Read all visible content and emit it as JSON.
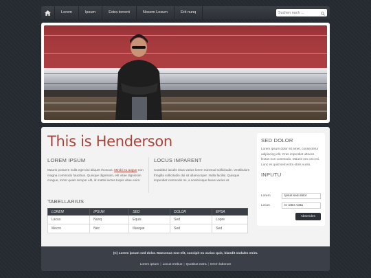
{
  "nav": {
    "items": [
      "Lorem",
      "Ipsum",
      "Extra torrent",
      "Nosem Lesum",
      "Erit nunq"
    ]
  },
  "search": {
    "placeholder": "Suchen nach ..."
  },
  "main": {
    "title": "This is Henderson",
    "col1": {
      "heading": "LOREM IPSUM",
      "text_a": "Mauris posuere nulla eget dui aliquet rhoncus. ",
      "link": "Mircbi eu augue",
      "text_b": " non magna commodo faucibus. Quisque dignissim, elit vitae dignissim congue, tortor quam tempor elit, id mattis lectus turpis vitae enim."
    },
    "col2": {
      "heading": "LOCUS IMPARENT",
      "text": "Curabitur iaculis risus varius lorem euismod sollicitudin. Vestibulum fringilla sollicitudin dui sit ullamcorper. Nulla facilisi. Quisque imperdiet commodo mi, a scelerisque lacus varius at."
    },
    "table": {
      "heading": "TABELLARIUS",
      "columns": [
        "LOREM",
        "IPSUM",
        "SED",
        "DOLOR",
        "EPSA"
      ],
      "rows": [
        [
          "Lacus",
          "Nunq",
          "Equis",
          "Sed",
          "Lopre"
        ],
        [
          "Mecro",
          "Nec",
          "Illusque",
          "Sed",
          "Sed"
        ]
      ]
    }
  },
  "sidebar": {
    "heading1": "SED DOLOR",
    "text1": "Lorem ipsum dolor sit amet, consectetur adipiscing elit. Cras imperdiet ultrices lectus non commodo. Mauris nec orci mi. Lunc es quid sed extra obris vunlu.",
    "heading2": "INPUTU",
    "fields": [
      {
        "label": "Lorem",
        "value": "Ipsus sed dolor"
      },
      {
        "label": "Locus",
        "value": "In orbis vista"
      }
    ],
    "submit_label": "Absenden"
  },
  "footer": {
    "copyright": "(C) Lorem ipsum sed dolor. Maecenas erat elit, suscipit eu varius quis, blandit sodales enim.",
    "links": [
      "Lorem ipsum",
      "Locus erebus",
      "Quotitus extra",
      "Orem laborum"
    ]
  },
  "colors": {
    "accent": "#a5443a",
    "nav_bg": "#2d3037",
    "page_bg": "#262a31",
    "panel_bg": "#f3f3f3"
  },
  "icons": [
    "home-icon",
    "search-icon"
  ]
}
